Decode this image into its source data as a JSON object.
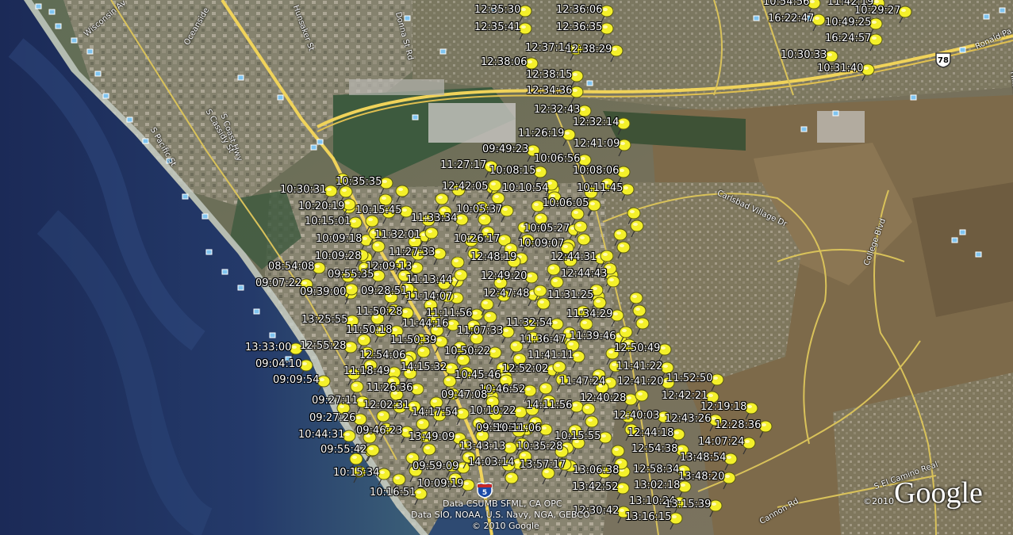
{
  "map": {
    "timestamps": [
      "12:35:30",
      "12:36:06",
      "12:35:41",
      "12:36:35",
      "12:37:14",
      "12:38:29",
      "12:38:06",
      "12:38:15",
      "12:34:36",
      "12:32:43",
      "12:32:14",
      "11:26:19",
      "12:41:09",
      "09:49:23",
      "10:06:56",
      "11:27:17",
      "10:08:15",
      "10:08:06",
      "12:42:05",
      "10:10:54",
      "10:11:45",
      "10:06:05",
      "10:05:37",
      "10:05:27",
      "10:35:35",
      "10:30:31",
      "10:20:19",
      "10:15:45",
      "10:15:01",
      "11:33:34",
      "10:09:18",
      "11:32:01",
      "10:26:17",
      "10:09:07",
      "10:09:28",
      "11:27:33",
      "12:48:19",
      "12:44:31",
      "08:54:08",
      "12:09:13",
      "12:44:43",
      "09:55:35",
      "11:13:44",
      "12:49:20",
      "09:07:22",
      "09:39:00",
      "09:28:51",
      "11:14:07",
      "12:47:48",
      "11:31:25",
      "11:50:28",
      "11:11:56",
      "11:34:29",
      "13:25:55",
      "11:44:16",
      "11:32:54",
      "11:50:18",
      "11:07:33",
      "11:36:47",
      "11:39:46",
      "11:50:39",
      "12:50:49",
      "13:33:00",
      "12:55:28",
      "12:54:06",
      "10:50:22",
      "11:41:11",
      "09:04:10",
      "14:15:32",
      "11:41:22",
      "11:52:50",
      "11:18:49",
      "10:45:46",
      "12:52:02",
      "09:09:54",
      "11:47:24",
      "12:41:20",
      "12:42:21",
      "11:26:36",
      "10:46:52",
      "09:47:08",
      "12:40:28",
      "09:27:11",
      "12:02:31",
      "14:17:54",
      "10:10:22",
      "14:11:56",
      "12:40:03",
      "12:19:18",
      "09:27:26",
      "12:43:26",
      "12:28:36",
      "09:46:23",
      "09:59:31",
      "10:11:06",
      "10:44:31",
      "13:49:09",
      "10:15:55",
      "12:44:18",
      "14:07:24",
      "09:55:42",
      "13:43:13",
      "10:35:28",
      "12:54:38",
      "13:48:54",
      "14:03:14",
      "13:57:17",
      "09:59:09",
      "13:06:38",
      "12:58:34",
      "10:15:34",
      "13:48:20",
      "10:09:19",
      "13:42:52",
      "13:02:18",
      "10:16:51",
      "13:10:24",
      "13:15:39",
      "12:30:42",
      "13:16:15",
      "10:54:56",
      "11:42:19",
      "10:29:27",
      "16:22:47",
      "10:49:25",
      "16:24:57",
      "10:30:33",
      "10:31:40"
    ],
    "road_labels": [
      "Wisconsin Av",
      "Oceanside",
      "Hunsaker St",
      "Donna St Rd",
      "S Pacific St",
      "S Coast Hwy",
      "S Cassidy St",
      "Carlsbad Village Dr",
      "College Blvd",
      "S El Camino Real",
      "Cannon Rd",
      "Ronald Pa",
      "Hillside Ln"
    ],
    "highway_shields": [
      "78",
      "5"
    ],
    "attribution": [
      "Data CSUMB SFML, CA OPC",
      "Data SIO, NOAA, U.S. Navy, NGA, GEBCO",
      "© 2010 Google"
    ],
    "copyright_year": "©2010",
    "brand": "Google"
  }
}
